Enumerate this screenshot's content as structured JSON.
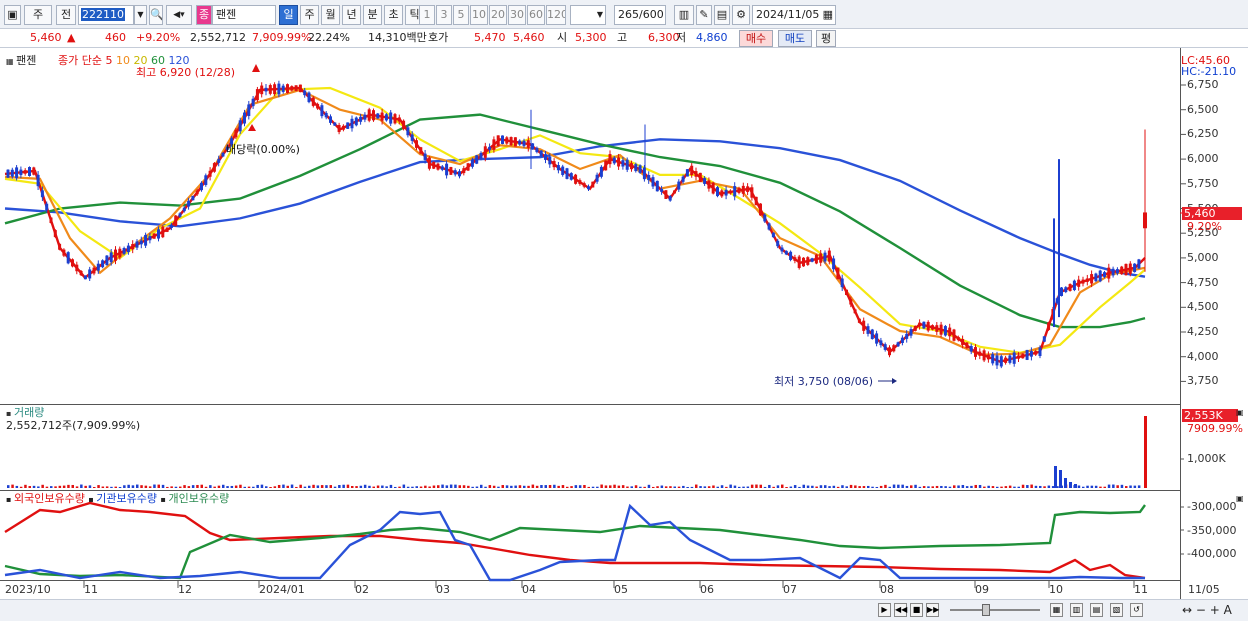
{
  "toolbar": {
    "type_label": "주",
    "period_label": "전",
    "code": "222110",
    "stock_badge": "종",
    "stock_name": "팬젠",
    "periods": [
      "일",
      "주",
      "월",
      "년",
      "분",
      "초",
      "틱"
    ],
    "active_period": "일",
    "intervals": [
      "1",
      "3",
      "5",
      "10",
      "20",
      "30",
      "60",
      "120"
    ],
    "count": "265",
    "count_total": "/600",
    "date": "2024/11/05"
  },
  "quote": {
    "price": "5,460",
    "change_arrow": "▲",
    "change": "460",
    "change_pct": "+9.20%",
    "volume": "2,552,712",
    "volume_ratio": "7,909.99%",
    "turnover": "22.24%",
    "amount": "14,310백만",
    "bid_label": "호가",
    "bid1": "5,470",
    "bid2": "5,460",
    "open_label": "시",
    "open": "5,300",
    "high_label": "고",
    "high": "6,300",
    "low_label": "저",
    "low": "4,860",
    "buy_label": "매수",
    "sell_label": "매도",
    "eval_label": "평"
  },
  "price_panel": {
    "stock": "팬젠",
    "ma_title": "종가 단순",
    "ma_periods": [
      "5",
      "10",
      "20",
      "60",
      "120"
    ],
    "high_note": "최고 6,920 (12/28)",
    "low_note": "최저 3,750 (08/06)",
    "split_note": "배당락(0.00%)",
    "lc": "LC:45.60",
    "hc": "HC:-21.10",
    "yticks": [
      "6,750",
      "6,500",
      "6,250",
      "6,000",
      "5,750",
      "5,500",
      "5,250",
      "5,000",
      "4,750",
      "4,500",
      "4,250",
      "4,000",
      "3,750"
    ],
    "cur_price": "5,460",
    "cur_pct": "9.20%"
  },
  "volume_panel": {
    "title": "거래량",
    "value": "2,552,712주(7,909.99%)",
    "ytick": "1,000K",
    "cur": "2,553K",
    "cur_pct": "7909.99%"
  },
  "holding_panel": {
    "foreign": "외국인보유수량",
    "inst": "기관보유수량",
    "indiv": "개인보유수량",
    "yticks": [
      "-300,000",
      "-350,000",
      "-400,000"
    ]
  },
  "xaxis": [
    "2023/10",
    "11",
    "12",
    "2024/01",
    "02",
    "03",
    "04",
    "05",
    "06",
    "07",
    "08",
    "09",
    "10",
    "11",
    "11/05"
  ],
  "colors": {
    "ma5": "#e01010",
    "ma10": "#f08a1a",
    "ma20": "#f4e812",
    "ma60": "#20903a",
    "ma120": "#2a52d8",
    "up": "#e01010",
    "down": "#1c3fd0"
  }
}
